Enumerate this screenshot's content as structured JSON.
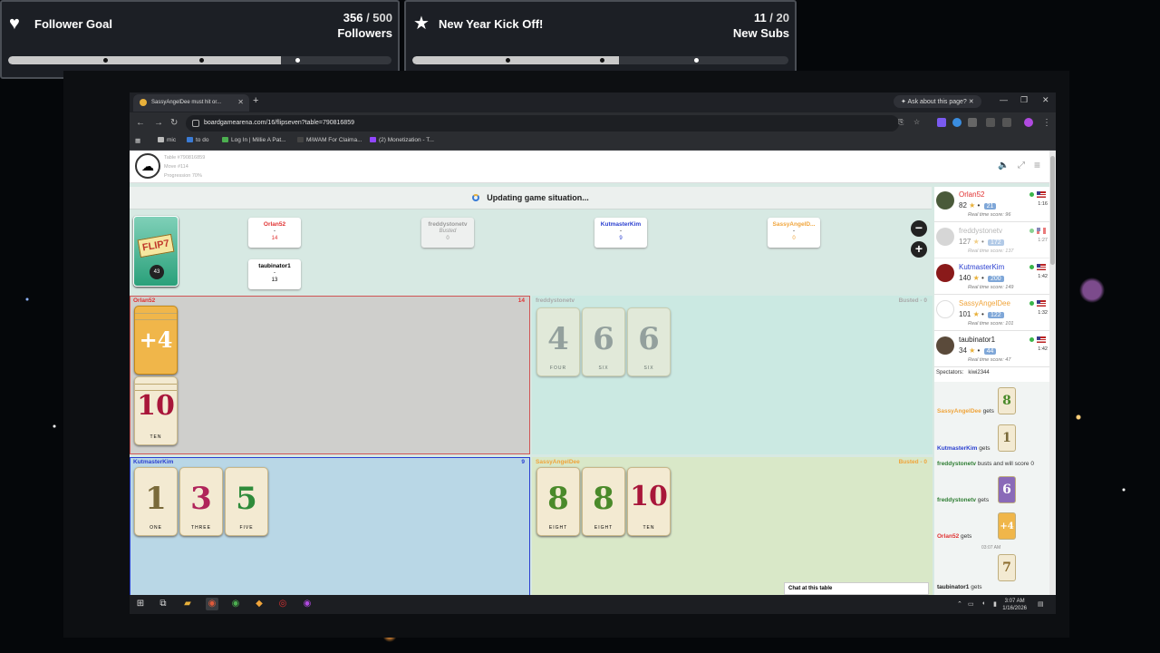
{
  "overlay": {
    "follower_goal": {
      "title": "Follower Goal",
      "current": "356",
      "sep": " / ",
      "target": "500",
      "unit": "Followers",
      "progress": 0.712
    },
    "sub_goal": {
      "title": "New Year Kick Off!",
      "current": "11",
      "sep": " / ",
      "target": "20",
      "unit": "New Subs",
      "progress": 0.55
    }
  },
  "browser": {
    "tab_title": "SassyAngelDee must hit or...",
    "ask_button": "Ask about this page?",
    "url": "boardgamearena.com/16/flipseven?table=790816859",
    "bookmarks": [
      "mic",
      "to do",
      "Log In | Millie A Pat...",
      "MiWAM For Claima...",
      "(2) Monetization - T..."
    ]
  },
  "table": {
    "table_id": "Table #790816859",
    "move": "Move #114",
    "progression": "Progression 70%",
    "status": "Updating game situation...",
    "deck_count": "43",
    "deck_logo": "FLIP7",
    "zoom_out": "−",
    "zoom_in": "+"
  },
  "scoreboxes": [
    {
      "name": "Orlan52",
      "sub": "-",
      "score": "14",
      "color": "#e03131"
    },
    {
      "name": "freddystonetv",
      "sub": "Busted",
      "score": "0",
      "color": "#999999"
    },
    {
      "name": "KutmasterKim",
      "sub": "-",
      "score": "9",
      "color": "#2a3fd0"
    },
    {
      "name": "SassyAngelD...",
      "sub": "-",
      "score": "0",
      "color": "#f0a43a"
    },
    {
      "name": "taubinator1",
      "sub": "-",
      "score": "13",
      "color": "#222222"
    }
  ],
  "areas": {
    "orlan": {
      "name": "Orlan52",
      "score": "14",
      "cards": [
        {
          "num": "+4",
          "word": ""
        },
        {
          "num": "10",
          "word": "TEN"
        }
      ]
    },
    "freddy": {
      "name": "freddystonetv",
      "score": "Busted - 0",
      "cards": [
        {
          "num": "4",
          "word": "FOUR"
        },
        {
          "num": "6",
          "word": "SIX"
        },
        {
          "num": "6",
          "word": "SIX"
        }
      ]
    },
    "kim": {
      "name": "KutmasterKim",
      "score": "9",
      "cards": [
        {
          "num": "1",
          "word": "ONE"
        },
        {
          "num": "3",
          "word": "THREE"
        },
        {
          "num": "5",
          "word": "FIVE"
        }
      ]
    },
    "sassy": {
      "name": "SassyAngelDee",
      "score": "Busted - 0",
      "cards": [
        {
          "num": "8",
          "word": "EIGHT"
        },
        {
          "num": "8",
          "word": "EIGHT"
        },
        {
          "num": "10",
          "word": "TEN"
        }
      ]
    }
  },
  "players": [
    {
      "name": "Orlan52",
      "color": "#e03131",
      "points": "82",
      "elo": "21",
      "rt": "Real time score: 96",
      "time": "1:16"
    },
    {
      "name": "freddystonetv",
      "color": "#999999",
      "points": "127",
      "elo": "172",
      "rt": "Real time score: 137",
      "time": "1:27"
    },
    {
      "name": "KutmasterKim",
      "color": "#2a3fd0",
      "points": "140",
      "elo": "200",
      "rt": "Real time score: 149",
      "time": "1:42"
    },
    {
      "name": "SassyAngelDee",
      "color": "#f0a43a",
      "points": "101",
      "elo": "122",
      "rt": "Real time score: 101",
      "time": "1:32"
    },
    {
      "name": "taubinator1",
      "color": "#222222",
      "points": "34",
      "elo": "44",
      "rt": "Real time score: 47",
      "time": "1:42"
    }
  ],
  "spectators": {
    "label": "Spectators:",
    "value": "kiwi2344"
  },
  "log": {
    "l1_name": "SassyAngelDee",
    "l1_rest": " gets",
    "l1_card": "8",
    "l2_name": "KutmasterKim",
    "l2_rest": " gets",
    "l2_card": "1",
    "l3_name": "freddystonetv",
    "l3_rest": " busts and will score 0",
    "l4_name": "freddystonetv",
    "l4_rest": " gets",
    "l4_card": "6",
    "l5_name": "Orlan52",
    "l5_rest": " gets",
    "l5_card": "+4",
    "l5_time": "03:07 AM",
    "l6_name": "taubinator1",
    "l6_rest": " gets",
    "l6_card": "7"
  },
  "chat": "Chat at this table",
  "taskbar": {
    "time": "3:07 AM",
    "date": "1/16/2026"
  }
}
